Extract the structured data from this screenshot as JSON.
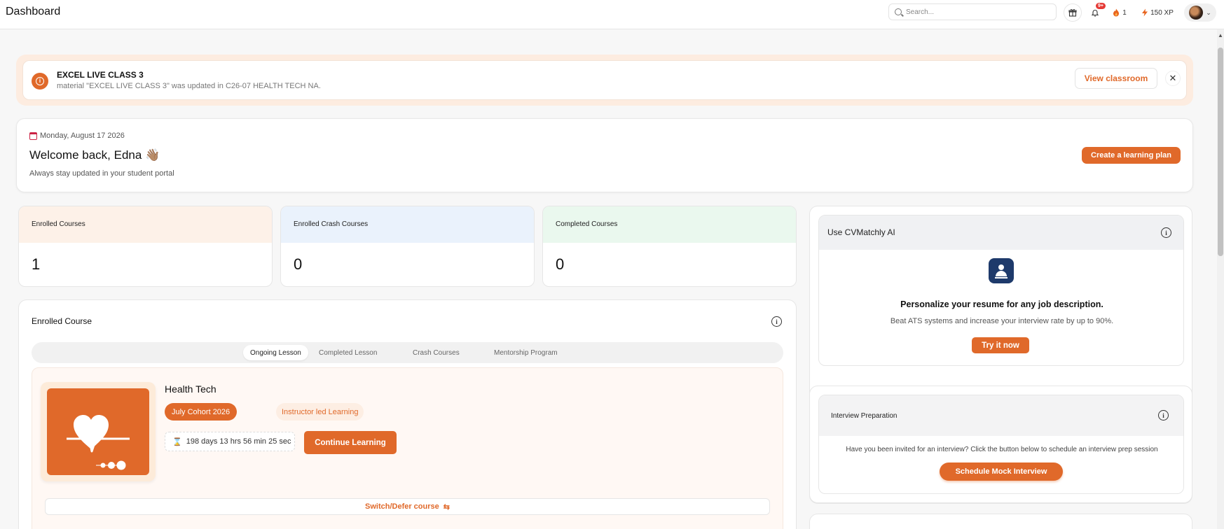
{
  "header": {
    "title": "Dashboard",
    "search_placeholder": "Search...",
    "notification_badge": "9+",
    "streak_count": "1",
    "xp": "150 XP"
  },
  "notice": {
    "title": "EXCEL LIVE CLASS 3",
    "message": "material \"EXCEL LIVE CLASS 3\" was updated in C26-07 HEALTH TECH NA.",
    "view_label": "View classroom",
    "close_symbol": "✕"
  },
  "welcome": {
    "date": "Monday, August 17 2026",
    "greeting": "Welcome back, Edna 👋🏽",
    "subtitle": "Always stay updated in your student portal",
    "create_plan_label": "Create a learning plan"
  },
  "stats": [
    {
      "label": "Enrolled Courses",
      "value": "1"
    },
    {
      "label": "Enrolled Crash Courses",
      "value": "0"
    },
    {
      "label": "Completed Courses",
      "value": "0"
    }
  ],
  "enrolled": {
    "title": "Enrolled Course",
    "tabs": [
      "Ongoing Lesson",
      "Completed Lesson",
      "Crash Courses",
      "Mentorship Program"
    ],
    "active_tab": "Ongoing Lesson",
    "course": {
      "name": "Health Tech",
      "cohort": "July Cohort 2026",
      "mode": "Instructor led Learning",
      "countdown": "198 days 13 hrs 56 min 25 sec",
      "continue_label": "Continue Learning",
      "switch_label": "Switch/Defer course"
    }
  },
  "cvmatchly": {
    "title": "Use CVMatchly AI",
    "headline": "Personalize your resume for any job description.",
    "sub": "Beat ATS systems and increase your interview rate by up to 90%.",
    "cta": "Try it now"
  },
  "interview": {
    "title": "Interview Preparation",
    "text": "Have you been invited for an interview? Click the button below to schedule an interview prep session",
    "cta": "Schedule Mock Interview"
  },
  "colors": {
    "accent": "#e0692a",
    "stat_enrolled_bg": "#fdf1e8",
    "stat_crash_bg": "#eaf2fc",
    "stat_completed_bg": "#eaf8ee",
    "cv_logo_bg": "#1e3a6b"
  },
  "icons": [
    "search-icon",
    "gift-icon",
    "bell-icon",
    "fire-icon",
    "bolt-icon",
    "info-icon",
    "close-icon",
    "calendar-icon",
    "hourglass-icon",
    "swap-icon",
    "chevron-down-icon"
  ]
}
